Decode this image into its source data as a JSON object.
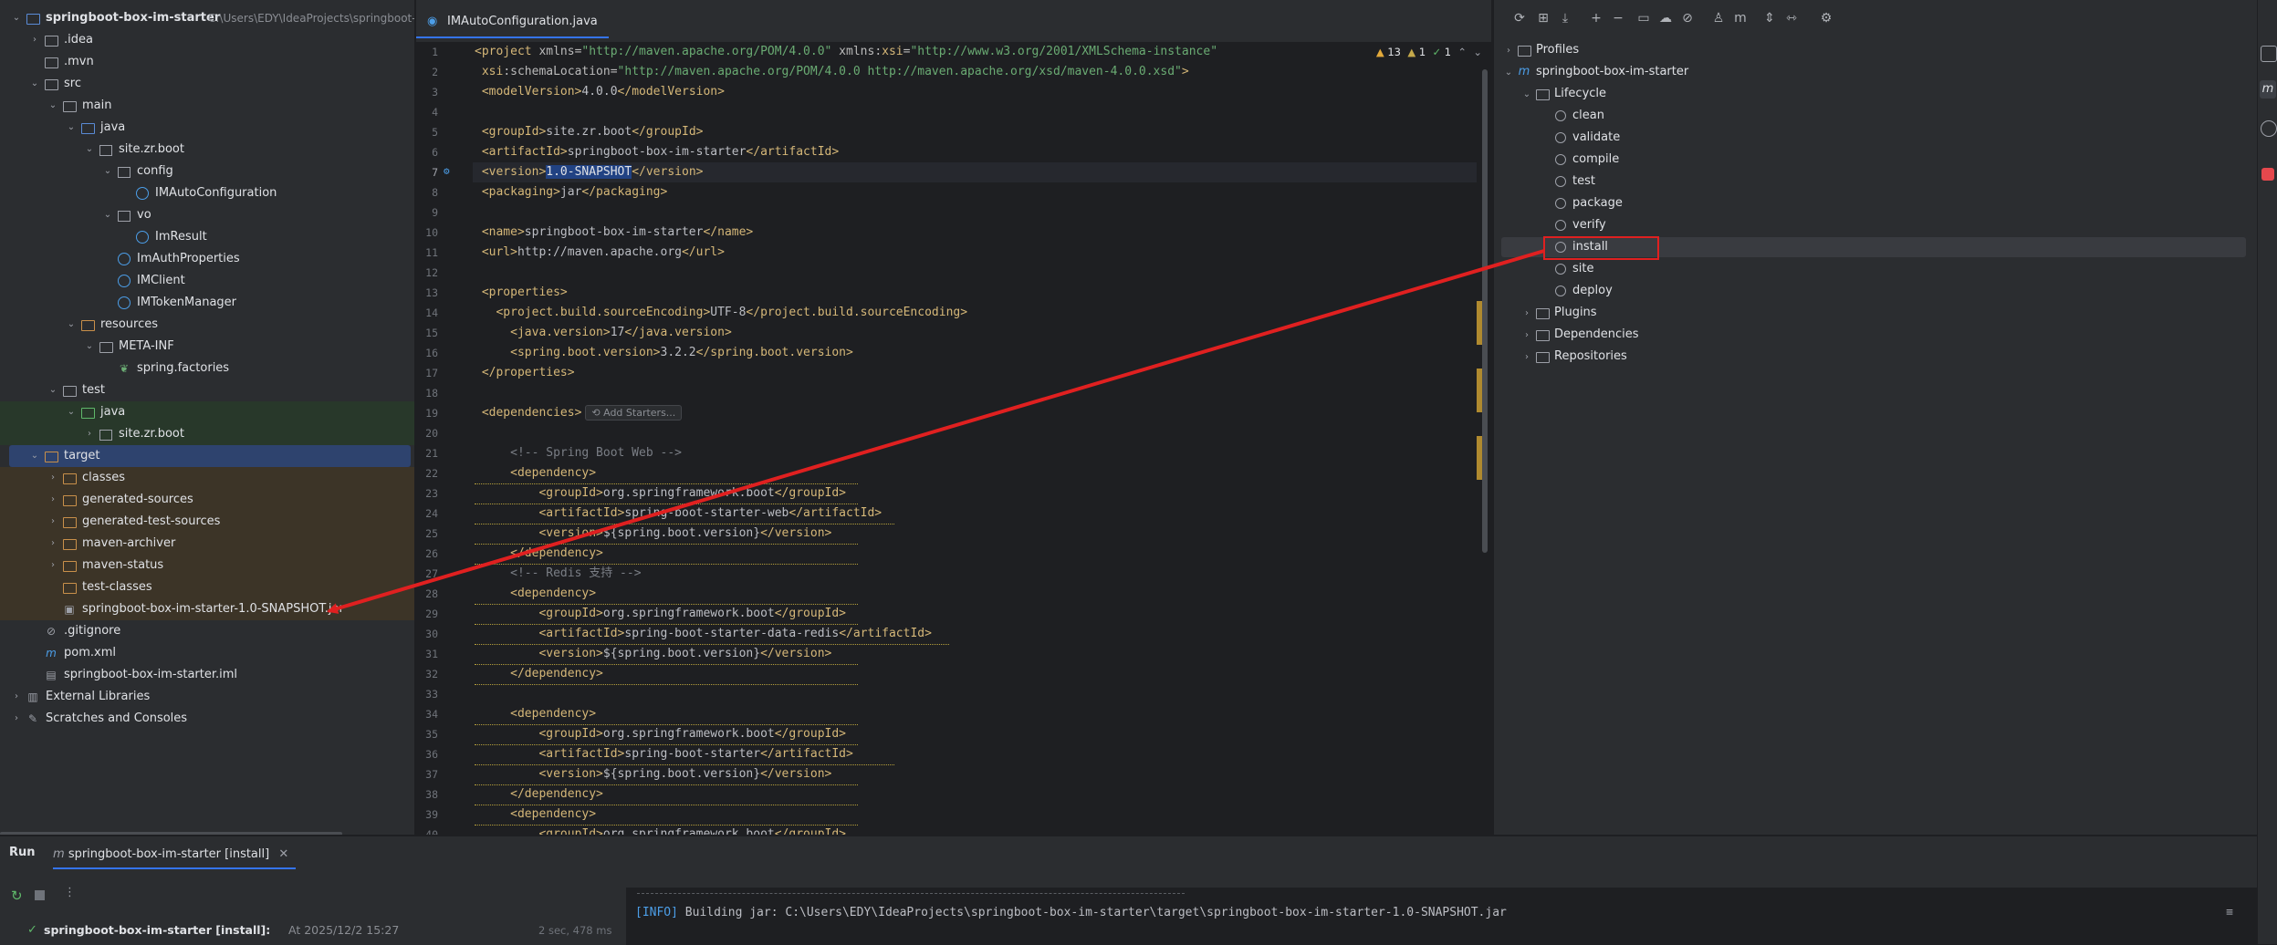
{
  "project": {
    "root_name": "springboot-box-im-starter",
    "root_path": "C:\\Users\\EDY\\IdeaProjects\\springboot-b",
    "items": [
      {
        "label": "springboot-box-im-starter",
        "depth": 0,
        "open": true,
        "icon": "module-folder-icon",
        "extra": "C:\\Users\\EDY\\IdeaProjects\\springboot-b",
        "bold": true
      },
      {
        "label": ".idea",
        "depth": 1,
        "open": false,
        "icon": "folder-icon"
      },
      {
        "label": ".mvn",
        "depth": 1,
        "open": null,
        "icon": "folder-icon"
      },
      {
        "label": "src",
        "depth": 1,
        "open": true,
        "icon": "folder-icon"
      },
      {
        "label": "main",
        "depth": 2,
        "open": true,
        "icon": "folder-icon"
      },
      {
        "label": "java",
        "depth": 3,
        "open": true,
        "icon": "source-folder-icon"
      },
      {
        "label": "site.zr.boot",
        "depth": 4,
        "open": true,
        "icon": "package-icon"
      },
      {
        "label": "config",
        "depth": 5,
        "open": true,
        "icon": "package-icon"
      },
      {
        "label": "IMAutoConfiguration",
        "depth": 6,
        "open": null,
        "icon": "class-icon"
      },
      {
        "label": "vo",
        "depth": 5,
        "open": true,
        "icon": "package-icon"
      },
      {
        "label": "ImResult",
        "depth": 6,
        "open": null,
        "icon": "class-icon"
      },
      {
        "label": "ImAuthProperties",
        "depth": 5,
        "open": null,
        "icon": "class-icon"
      },
      {
        "label": "IMClient",
        "depth": 5,
        "open": null,
        "icon": "class-icon"
      },
      {
        "label": "IMTokenManager",
        "depth": 5,
        "open": null,
        "icon": "class-icon"
      },
      {
        "label": "resources",
        "depth": 3,
        "open": true,
        "icon": "resources-folder-icon"
      },
      {
        "label": "META-INF",
        "depth": 4,
        "open": true,
        "icon": "folder-icon"
      },
      {
        "label": "spring.factories",
        "depth": 5,
        "open": null,
        "icon": "spring-file-icon"
      },
      {
        "label": "test",
        "depth": 2,
        "open": true,
        "icon": "folder-icon"
      },
      {
        "label": "java",
        "depth": 3,
        "open": true,
        "icon": "test-source-folder-icon",
        "bg": "green"
      },
      {
        "label": "site.zr.boot",
        "depth": 4,
        "open": false,
        "icon": "package-icon",
        "bg": "green"
      },
      {
        "label": "target",
        "depth": 1,
        "open": true,
        "icon": "excluded-folder-icon",
        "bg": "selected"
      },
      {
        "label": "classes",
        "depth": 2,
        "open": false,
        "icon": "excluded-folder-icon",
        "bg": "orange"
      },
      {
        "label": "generated-sources",
        "depth": 2,
        "open": false,
        "icon": "excluded-folder-icon",
        "bg": "orange"
      },
      {
        "label": "generated-test-sources",
        "depth": 2,
        "open": false,
        "icon": "excluded-folder-icon",
        "bg": "orange"
      },
      {
        "label": "maven-archiver",
        "depth": 2,
        "open": false,
        "icon": "excluded-folder-icon",
        "bg": "orange"
      },
      {
        "label": "maven-status",
        "depth": 2,
        "open": false,
        "icon": "excluded-folder-icon",
        "bg": "orange"
      },
      {
        "label": "test-classes",
        "depth": 2,
        "open": null,
        "icon": "excluded-folder-icon",
        "bg": "orange"
      },
      {
        "label": "springboot-box-im-starter-1.0-SNAPSHOT.jar",
        "depth": 2,
        "open": null,
        "icon": "jar-icon",
        "bg": "orange"
      },
      {
        "label": ".gitignore",
        "depth": 1,
        "open": null,
        "icon": "gitignore-icon"
      },
      {
        "label": "pom.xml",
        "depth": 1,
        "open": null,
        "icon": "maven-icon"
      },
      {
        "label": "springboot-box-im-starter.iml",
        "depth": 1,
        "open": null,
        "icon": "iml-icon"
      },
      {
        "label": "External Libraries",
        "depth": 0,
        "open": false,
        "icon": "libraries-icon"
      },
      {
        "label": "Scratches and Consoles",
        "depth": 0,
        "open": false,
        "icon": "scratches-icon"
      }
    ]
  },
  "editor": {
    "tab_label": "IMAutoConfiguration.java",
    "inspections": {
      "warnings": "13",
      "weak_warnings": "1",
      "ok": "1"
    },
    "add_starters": "Add Starters...",
    "lines": [
      {
        "n": "1",
        "parts": [
          [
            "tag",
            "<project "
          ],
          [
            "attr",
            "xmlns="
          ],
          [
            "str",
            "\"http://maven.apache.org/POM/4.0.0\""
          ],
          [
            "attr",
            " xmlns:"
          ],
          [
            "tag",
            "xsi"
          ],
          [
            "attr",
            "="
          ],
          [
            "str",
            "\"http://www.w3.org/2001/XMLSchema-instance\""
          ]
        ]
      },
      {
        "n": "2",
        "parts": [
          [
            "tag",
            " xsi"
          ],
          [
            "attr",
            ":schemaLocation="
          ],
          [
            "str",
            "\"http://maven.apache.org/POM/4.0.0 http://maven.apache.org/xsd/maven-4.0.0.xsd\""
          ],
          [
            "tag",
            ">"
          ]
        ]
      },
      {
        "n": "3",
        "parts": [
          [
            "tag",
            " <modelVersion>"
          ],
          [
            "txt",
            "4.0.0"
          ],
          [
            "tag",
            "</modelVersion>"
          ]
        ]
      },
      {
        "n": "4",
        "parts": []
      },
      {
        "n": "5",
        "parts": [
          [
            "tag",
            " <groupId>"
          ],
          [
            "txt",
            "site.zr.boot"
          ],
          [
            "tag",
            "</groupId>"
          ]
        ]
      },
      {
        "n": "6",
        "parts": [
          [
            "tag",
            " <artifactId>"
          ],
          [
            "txt",
            "springboot-box-im-starter"
          ],
          [
            "tag",
            "</artifactId>"
          ]
        ]
      },
      {
        "n": "7",
        "parts": [
          [
            "tag",
            " <version>"
          ],
          [
            "hl",
            "1.0-SNAPSHOT"
          ],
          [
            "tag",
            "</version>"
          ]
        ]
      },
      {
        "n": "8",
        "parts": [
          [
            "tag",
            " <packaging>"
          ],
          [
            "txt",
            "jar"
          ],
          [
            "tag",
            "</packaging>"
          ]
        ]
      },
      {
        "n": "9",
        "parts": []
      },
      {
        "n": "10",
        "parts": [
          [
            "tag",
            " <name>"
          ],
          [
            "txt",
            "springboot-box-im-starter"
          ],
          [
            "tag",
            "</name>"
          ]
        ]
      },
      {
        "n": "11",
        "parts": [
          [
            "tag",
            " <url>"
          ],
          [
            "txt",
            "http://maven.apache.org"
          ],
          [
            "tag",
            "</url>"
          ]
        ]
      },
      {
        "n": "12",
        "parts": []
      },
      {
        "n": "13",
        "parts": [
          [
            "tag",
            " <properties>"
          ]
        ]
      },
      {
        "n": "14",
        "parts": [
          [
            "tag",
            "   <project.build.sourceEncoding>"
          ],
          [
            "txt",
            "UTF-8"
          ],
          [
            "tag",
            "</project.build.sourceEncoding>"
          ]
        ]
      },
      {
        "n": "15",
        "parts": [
          [
            "tag",
            "     <java.version>"
          ],
          [
            "txt",
            "17"
          ],
          [
            "tag",
            "</java.version>"
          ]
        ]
      },
      {
        "n": "16",
        "parts": [
          [
            "tag",
            "     <spring.boot.version>"
          ],
          [
            "txt",
            "3.2.2"
          ],
          [
            "tag",
            "</spring.boot.version>"
          ]
        ]
      },
      {
        "n": "17",
        "parts": [
          [
            "tag",
            " </properties>"
          ]
        ]
      },
      {
        "n": "18",
        "parts": []
      },
      {
        "n": "19",
        "parts": [
          [
            "tag",
            " <dependencies>"
          ]
        ]
      },
      {
        "n": "20",
        "parts": []
      },
      {
        "n": "21",
        "parts": [
          [
            "cmt",
            "     <!-- Spring Boot Web -->"
          ]
        ]
      },
      {
        "n": "22",
        "parts": [
          [
            "tag",
            "     <dependency>"
          ]
        ]
      },
      {
        "n": "23",
        "parts": [
          [
            "tag",
            "         <groupId>"
          ],
          [
            "txt",
            "org.springframework.boot"
          ],
          [
            "tag",
            "</groupId>"
          ]
        ]
      },
      {
        "n": "24",
        "parts": [
          [
            "tag",
            "         <artifactId>"
          ],
          [
            "txt",
            "spring-boot-starter-web"
          ],
          [
            "tag",
            "</artifactId>"
          ]
        ]
      },
      {
        "n": "25",
        "parts": [
          [
            "tag",
            "         <version>"
          ],
          [
            "txt",
            "${spring.boot.version}"
          ],
          [
            "tag",
            "</version>"
          ]
        ]
      },
      {
        "n": "26",
        "parts": [
          [
            "tag",
            "     </dependency>"
          ]
        ]
      },
      {
        "n": "27",
        "parts": [
          [
            "cmt",
            "     <!-- Redis 支持 -->"
          ]
        ]
      },
      {
        "n": "28",
        "parts": [
          [
            "tag",
            "     <dependency>"
          ]
        ]
      },
      {
        "n": "29",
        "parts": [
          [
            "tag",
            "         <groupId>"
          ],
          [
            "txt",
            "org.springframework.boot"
          ],
          [
            "tag",
            "</groupId>"
          ]
        ]
      },
      {
        "n": "30",
        "parts": [
          [
            "tag",
            "         <artifactId>"
          ],
          [
            "txt",
            "spring-boot-starter-data-redis"
          ],
          [
            "tag",
            "</artifactId>"
          ]
        ]
      },
      {
        "n": "31",
        "parts": [
          [
            "tag",
            "         <version>"
          ],
          [
            "txt",
            "${spring.boot.version}"
          ],
          [
            "tag",
            "</version>"
          ]
        ]
      },
      {
        "n": "32",
        "parts": [
          [
            "tag",
            "     </dependency>"
          ]
        ]
      },
      {
        "n": "33",
        "parts": []
      },
      {
        "n": "34",
        "parts": [
          [
            "tag",
            "     <dependency>"
          ]
        ]
      },
      {
        "n": "35",
        "parts": [
          [
            "tag",
            "         <groupId>"
          ],
          [
            "txt",
            "org.springframework.boot"
          ],
          [
            "tag",
            "</groupId>"
          ]
        ]
      },
      {
        "n": "36",
        "parts": [
          [
            "tag",
            "         <artifactId>"
          ],
          [
            "txt",
            "spring-boot-starter"
          ],
          [
            "tag",
            "</artifactId>"
          ]
        ]
      },
      {
        "n": "37",
        "parts": [
          [
            "tag",
            "         <version>"
          ],
          [
            "txt",
            "${spring.boot.version}"
          ],
          [
            "tag",
            "</version>"
          ]
        ]
      },
      {
        "n": "38",
        "parts": [
          [
            "tag",
            "     </dependency>"
          ]
        ]
      },
      {
        "n": "39",
        "parts": [
          [
            "tag",
            "     <dependency>"
          ]
        ]
      },
      {
        "n": "40",
        "parts": [
          [
            "tag",
            "         <groupId>"
          ],
          [
            "txt",
            "org.springframework.boot"
          ],
          [
            "tag",
            "</groupId>"
          ]
        ]
      }
    ]
  },
  "maven": {
    "toolbar": [
      "reload-icon",
      "add-maven-project-icon",
      "download-icon",
      "plus-icon",
      "minus-icon",
      "lifecycle-icon",
      "offline-icon",
      "skip-tests-icon",
      "show-dependencies-icon",
      "execute-goal-icon",
      "expand-all-icon",
      "collapse-all-icon",
      "settings-icon"
    ],
    "profiles": "Profiles",
    "project": "springboot-box-im-starter",
    "lifecycle": "Lifecycle",
    "goals": [
      "clean",
      "validate",
      "compile",
      "test",
      "package",
      "verify",
      "install",
      "site",
      "deploy"
    ],
    "highlighted_goal": "install",
    "plugins": "Plugins",
    "dependencies": "Dependencies",
    "repositories": "Repositories"
  },
  "run": {
    "panel_title": "Run",
    "tab_label": "springboot-box-im-starter [install]",
    "entry_name": "springboot-box-im-starter [install]:",
    "entry_time": "At 2025/12/2 15:27",
    "duration": "2 sec, 478 ms",
    "console_prefix": "[INFO]",
    "console_line": " Building jar: C:\\Users\\EDY\\IdeaProjects\\springboot-box-im-starter\\target\\springboot-box-im-starter-1.0-SNAPSHOT.jar"
  },
  "colors": {
    "accent": "#3574f0",
    "annotation": "#e02020",
    "tag": "#d5b778",
    "string": "#6aab73"
  }
}
